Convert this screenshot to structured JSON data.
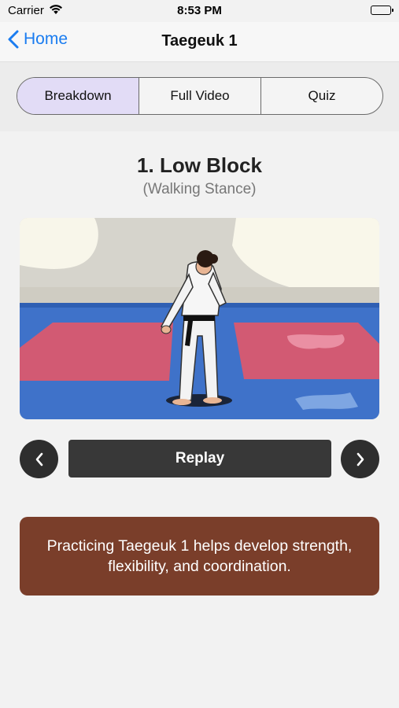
{
  "status": {
    "carrier": "Carrier",
    "time": "8:53 PM"
  },
  "nav": {
    "back_label": "Home",
    "title": "Taegeuk 1"
  },
  "segments": [
    {
      "label": "Breakdown",
      "selected": true
    },
    {
      "label": "Full Video",
      "selected": false
    },
    {
      "label": "Quiz",
      "selected": false
    }
  ],
  "move": {
    "title": "1. Low Block",
    "subtitle": "(Walking Stance)"
  },
  "controls": {
    "replay_label": "Replay",
    "prev_icon": "chevron-left-icon",
    "next_icon": "chevron-right-icon"
  },
  "info": {
    "text": "Practicing Taegeuk 1 helps develop strength, flexibility, and coordination."
  },
  "colors": {
    "accent": "#1a7cf0",
    "selected_segment": "#e2dcf6",
    "info_bg": "#7a3e2a",
    "button_bg": "#383838"
  }
}
